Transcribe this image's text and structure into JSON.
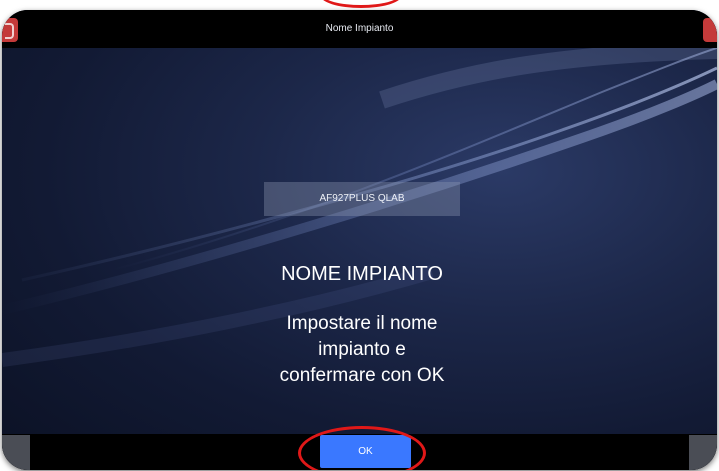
{
  "window": {
    "title": "Nome Impianto"
  },
  "form": {
    "plant_name_value": "AF927PLUS QLAB"
  },
  "overlay": {
    "heading": "NOME IMPIANTO",
    "instruction_lines": [
      "Impostare il nome",
      "impianto e",
      "confermare con OK"
    ]
  },
  "footer": {
    "ok_label": "OK"
  },
  "colors": {
    "accent_button": "#3a78ff",
    "annotation_circle": "#e01818",
    "corner_buttons": "#c43a3a",
    "background_dark": "#121a34"
  },
  "icons": {
    "top_left": "back-arrow-icon",
    "top_right": "close-icon"
  }
}
